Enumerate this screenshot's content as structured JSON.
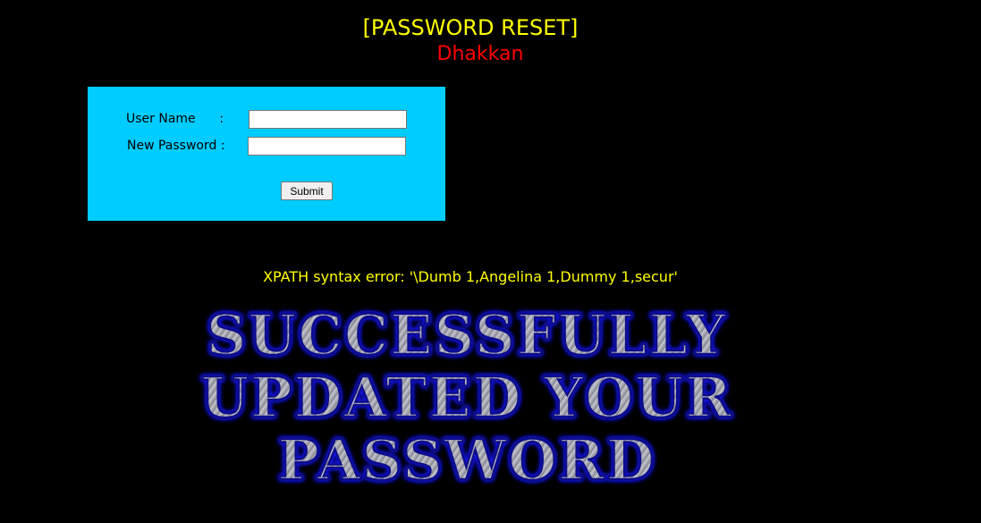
{
  "header": {
    "title": "[PASSWORD RESET]",
    "subtitle": "Dhakkan"
  },
  "form": {
    "username_label": "User Name      :",
    "new_password_label": "New Password :",
    "username_value": "",
    "new_password_value": "",
    "submit_label": "Submit"
  },
  "result": {
    "error_message": "XPATH syntax error: '\\Dumb 1,Angelina 1,Dummy 1,secur'",
    "banner_lines": [
      "SUCCESSFULLY",
      "UPDATED YOUR",
      "PASSWORD"
    ]
  },
  "colors": {
    "background": "#000000",
    "title": "#ffff00",
    "subtitle": "#ff0000",
    "form_background": "#00ccff",
    "error_text": "#ffff00",
    "banner_fill": "#a9a9b4",
    "banner_glow": "#1a1aff"
  }
}
